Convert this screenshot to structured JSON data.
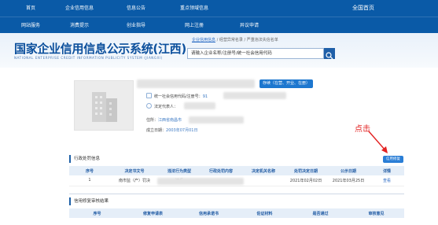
{
  "nav": {
    "row1": [
      "首页",
      "企业信用信息",
      "信息公告",
      "重点领域信息"
    ],
    "row1_home": "全国首页",
    "row2": [
      "网站服务",
      "消费提示",
      "创业指导",
      "网上注册",
      "异议申请"
    ]
  },
  "header": {
    "title": "国家企业信用信息公示系统(江西)",
    "subtitle": "NATIONAL ENTERPRISE CREDIT INFORMATION PUBLICITY SYSTEM (JIANGXI)"
  },
  "breadcrumb": {
    "items": [
      "企业信用信息",
      "经营异常名录",
      "严重违法失信名单"
    ],
    "separator": " / "
  },
  "search": {
    "placeholder": "请输入企业名称/注册号/统一社会信用代码"
  },
  "company": {
    "status_tag": "存续（在营、开业、在册）",
    "credit_code_label": "统一社会信用代码/注册号：",
    "credit_code_value": "91",
    "legal_rep_label": "法定代表人：",
    "address_label": "住所：",
    "address_value": "江西省南昌市",
    "established_label": "成立日期：",
    "established_value": "2003年07月01日"
  },
  "annotation": {
    "text": "点击",
    "color": "#e32222"
  },
  "penalty": {
    "section_title": "行政处罚信息",
    "repair_button": "信用修复",
    "columns": [
      "序号",
      "决定书文号",
      "违法行为类型",
      "行政处罚内容",
      "决定机关名称",
      "处罚决定日期",
      "公示日期",
      "详情"
    ],
    "rows": [
      [
        "1",
        "南市监（产）罚决",
        "违反",
        "",
        "",
        "2021年02月02日",
        "2021年03月25日",
        "查看"
      ]
    ]
  },
  "credit_repair": {
    "section_title": "信用修复审核结果",
    "columns": [
      "序号",
      "修复申请表",
      "信用承诺书",
      "佐证材料",
      "是否通过",
      "审核意见"
    ]
  },
  "colors": {
    "nav_bg": "#0a5aa7",
    "accent": "#1d77cf",
    "title_blue": "#0b4f9c"
  }
}
